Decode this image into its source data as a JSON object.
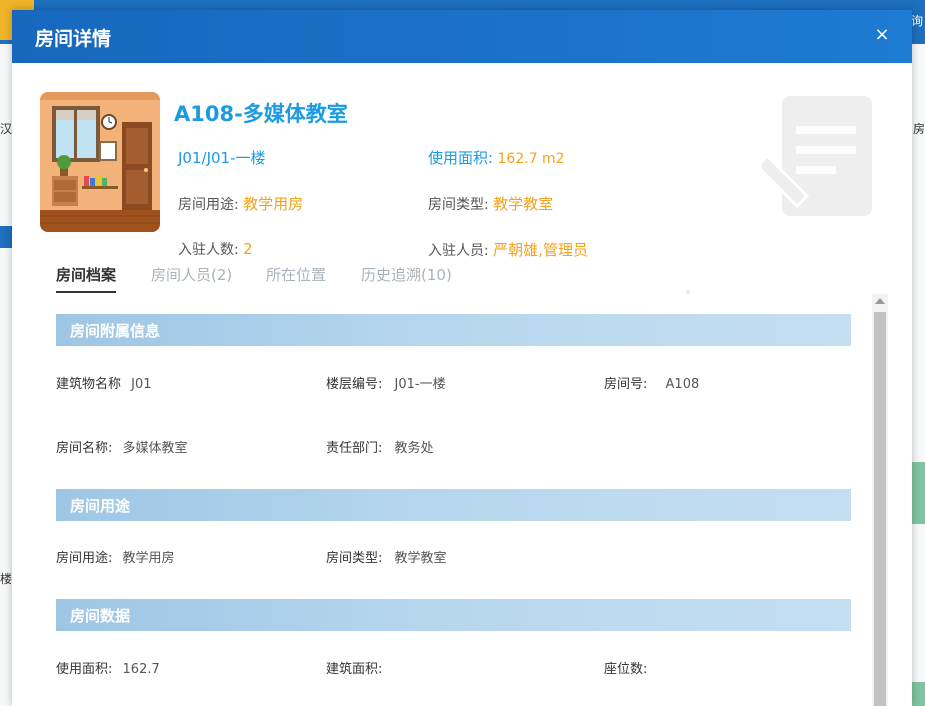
{
  "background": {
    "right_top_text": "询",
    "left_text_1": "汉",
    "left_text_2": "楼",
    "right_text": "房"
  },
  "modal": {
    "title": "房间详情",
    "close_label": "×"
  },
  "room": {
    "name": "A108-多媒体教室",
    "floor": "J01/J01-一楼",
    "usable_area_label": "使用面积:",
    "usable_area_value": "162.7 m2",
    "purpose_label": "房间用途:",
    "purpose_value": "教学用房",
    "type_label": "房间类型:",
    "type_value": "教学教室",
    "occupant_count_label": "入驻人数:",
    "occupant_count_value": "2",
    "occupants_label": "入驻人员:",
    "occupants_value": "严朝雄,管理员"
  },
  "tabs": [
    {
      "label": "房间档案",
      "active": true
    },
    {
      "label": "房间人员(2)",
      "active": false
    },
    {
      "label": "所在位置",
      "active": false
    },
    {
      "label": "历史追溯(10)",
      "active": false
    }
  ],
  "sections": {
    "attached_info": {
      "title": "房间附属信息",
      "building_name_label": "建筑物名称",
      "building_name_value": "J01",
      "floor_no_label": "楼层编号:",
      "floor_no_value": "J01-一楼",
      "room_no_label": "房间号:",
      "room_no_value": "A108",
      "room_name_label": "房间名称:",
      "room_name_value": "多媒体教室",
      "dept_label": "责任部门:",
      "dept_value": "教务处"
    },
    "purpose": {
      "title": "房间用途",
      "purpose_label": "房间用途:",
      "purpose_value": "教学用房",
      "type_label": "房间类型:",
      "type_value": "教学教室"
    },
    "data": {
      "title": "房间数据",
      "usable_area_label": "使用面积:",
      "usable_area_value": "162.7",
      "building_area_label": "建筑面积:",
      "building_area_value": "",
      "seats_label": "座位数:",
      "seats_value": ""
    }
  },
  "colors": {
    "header_blue": "#1767be",
    "accent_blue": "#1a9be3",
    "accent_orange": "#f4a21d",
    "section_bar": "#b7d7ee"
  }
}
